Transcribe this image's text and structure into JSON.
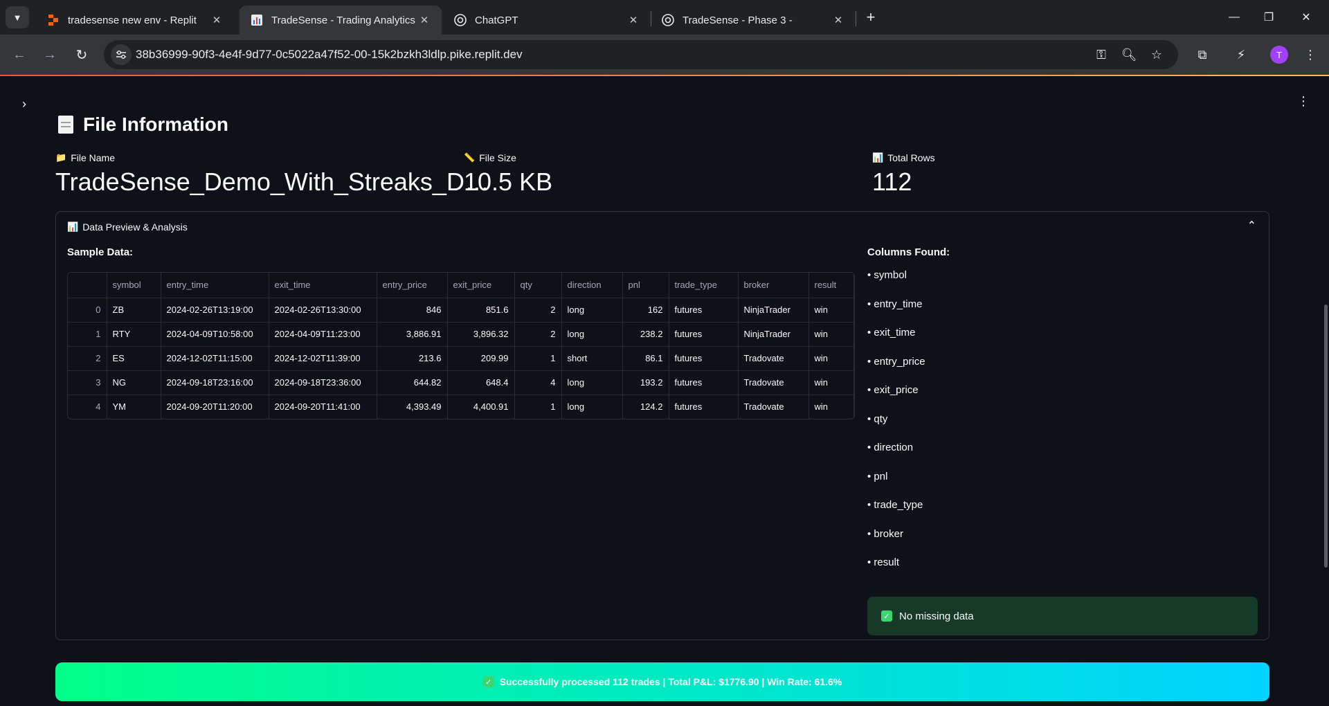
{
  "browser": {
    "tabs": [
      {
        "title": "tradesense new env - Replit",
        "icon": "replit-icon",
        "active": false
      },
      {
        "title": "TradeSense - Trading Analytics P",
        "icon": "bar-chart-icon",
        "active": true
      },
      {
        "title": "ChatGPT",
        "icon": "chatgpt-icon",
        "active": false
      },
      {
        "title": "TradeSense - Phase 3 -",
        "icon": "chatgpt-icon",
        "active": false
      }
    ],
    "url": "38b36999-90f3-4e4f-9d77-0c5022a47f52-00-15k2bzkh3ldlp.pike.replit.dev",
    "profile_initial": "T"
  },
  "file_info": {
    "title": "File Information",
    "metrics": [
      {
        "label": "File Name",
        "value": "TradeSense_Demo_With_Streaks_D…",
        "icon": "folder-icon"
      },
      {
        "label": "File Size",
        "value": "10.5 KB",
        "icon": "ruler-icon"
      },
      {
        "label": "Total Rows",
        "value": "112",
        "icon": "bar-chart-icon"
      }
    ]
  },
  "preview": {
    "expander_label": "Data Preview & Analysis",
    "sample_label": "Sample Data:",
    "columns": [
      "symbol",
      "entry_time",
      "exit_time",
      "entry_price",
      "exit_price",
      "qty",
      "direction",
      "pnl",
      "trade_type",
      "broker",
      "result"
    ],
    "rows": [
      [
        "0",
        "ZB",
        "2024-02-26T13:19:00",
        "2024-02-26T13:30:00",
        "846",
        "851.6",
        "2",
        "long",
        "162",
        "futures",
        "NinjaTrader",
        "win"
      ],
      [
        "1",
        "RTY",
        "2024-04-09T10:58:00",
        "2024-04-09T11:23:00",
        "3,886.91",
        "3,896.32",
        "2",
        "long",
        "238.2",
        "futures",
        "NinjaTrader",
        "win"
      ],
      [
        "2",
        "ES",
        "2024-12-02T11:15:00",
        "2024-12-02T11:39:00",
        "213.6",
        "209.99",
        "1",
        "short",
        "86.1",
        "futures",
        "Tradovate",
        "win"
      ],
      [
        "3",
        "NG",
        "2024-09-18T23:16:00",
        "2024-09-18T23:36:00",
        "644.82",
        "648.4",
        "4",
        "long",
        "193.2",
        "futures",
        "Tradovate",
        "win"
      ],
      [
        "4",
        "YM",
        "2024-09-20T11:20:00",
        "2024-09-20T11:41:00",
        "4,393.49",
        "4,400.91",
        "1",
        "long",
        "124.2",
        "futures",
        "Tradovate",
        "win"
      ]
    ],
    "columns_found_title": "Columns Found:",
    "columns_found": [
      "• symbol",
      "• entry_time",
      "• exit_time",
      "• entry_price",
      "• exit_price",
      "• qty",
      "• direction",
      "• pnl",
      "• trade_type",
      "• broker",
      "• result"
    ],
    "missing_status": "No missing data"
  },
  "banner": {
    "text": "Successfully processed 112 trades | Total P&L: $1776.90 | Win Rate: 61.6%"
  },
  "colors": {
    "background": "#0e1117",
    "success_bg": "#173928",
    "banner_start": "#00ff88",
    "banner_end": "#00d4ff"
  }
}
